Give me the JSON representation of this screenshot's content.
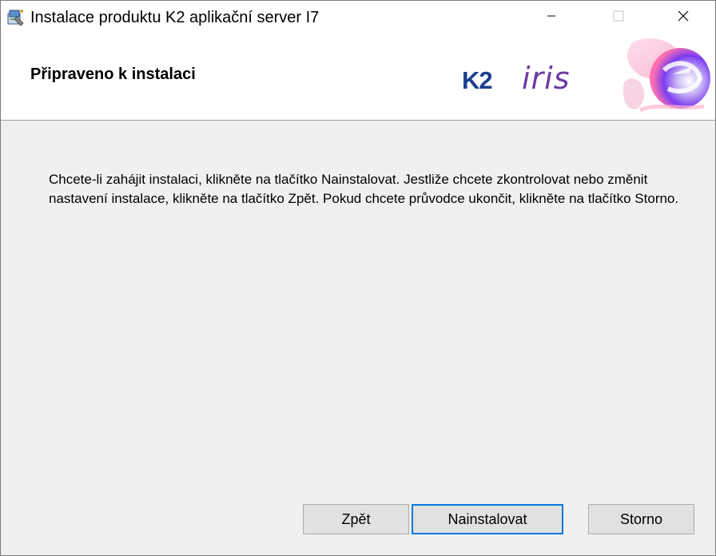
{
  "window": {
    "title": "Instalace produktu K2 aplikační server I7"
  },
  "banner": {
    "heading": "Připraveno k instalaci",
    "logo_k2": "K2",
    "logo_iris": "iris"
  },
  "content": {
    "message": "Chcete-li zahájit instalaci, klikněte na tlačítko Nainstalovat. Jestliže chcete zkontrolovat nebo změnit nastavení instalace, klikněte na tlačítko Zpět. Pokud chcete průvodce ukončit, klikněte na tlačítko Storno."
  },
  "buttons": {
    "back": "Zpět",
    "install": "Nainstalovat",
    "cancel": "Storno"
  },
  "colors": {
    "accent": "#0078d7",
    "logo_k2": "#1c3f8f",
    "logo_iris": "#6b3aa0"
  }
}
